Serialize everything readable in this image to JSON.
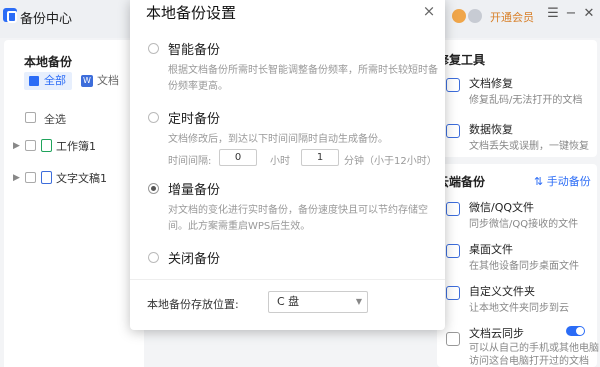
{
  "app": {
    "title": "备份中心",
    "vip_label": "开通会员"
  },
  "window_controls": {
    "menu": "☰",
    "minimize": "−",
    "close": "✕"
  },
  "left_panel": {
    "title": "本地备份",
    "tabs": [
      {
        "label": "全部"
      },
      {
        "label": "文档"
      }
    ],
    "select_all": "全选",
    "files": [
      {
        "name": "工作簿1",
        "type": "sheet"
      },
      {
        "name": "文字文稿1",
        "type": "doc"
      }
    ]
  },
  "repair_tools": {
    "title": "修复工具",
    "items": [
      {
        "name": "文档修复",
        "desc": "修复乱码/无法打开的文档"
      },
      {
        "name": "数据恢复",
        "desc": "文档丢失或误删，一键恢复"
      }
    ]
  },
  "cloud_backup": {
    "title": "云端备份",
    "manual_label": "手动备份",
    "items": [
      {
        "name": "微信/QQ文件",
        "desc": "同步微信/QQ接收的文件"
      },
      {
        "name": "桌面文件",
        "desc": "在其他设备同步桌面文件"
      },
      {
        "name": "自定义文件夹",
        "desc": "让本地文件夹同步到云"
      },
      {
        "name": "文档云同步",
        "desc": "可以从自己的手机或其他电脑",
        "desc2": "访问这台电脑打开过的文档",
        "toggle_on": true
      }
    ]
  },
  "dialog": {
    "title": "本地备份设置",
    "close": "×",
    "options": [
      {
        "label": "智能备份",
        "desc": "根据文档备份所需时长智能调整备份频率，所需时长较短时备份频率更高。",
        "selected": false
      },
      {
        "label": "定时备份",
        "desc": "文档修改后，到达以下时间间隔时自动生成备份。",
        "selected": false
      },
      {
        "label": "增量备份",
        "desc": "对文档的变化进行实时备份，备份速度快且可以节约存储空间。此方案需重启WPS后生效。",
        "selected": true
      },
      {
        "label": "关闭备份",
        "desc": "",
        "selected": false
      }
    ],
    "interval": {
      "label": "时间间隔:",
      "hours": "0",
      "hours_unit": "小时",
      "minutes": "1",
      "minutes_unit": "分钟（小于12小时）"
    },
    "location": {
      "label": "本地备份存放位置:",
      "value": "C 盘"
    }
  }
}
